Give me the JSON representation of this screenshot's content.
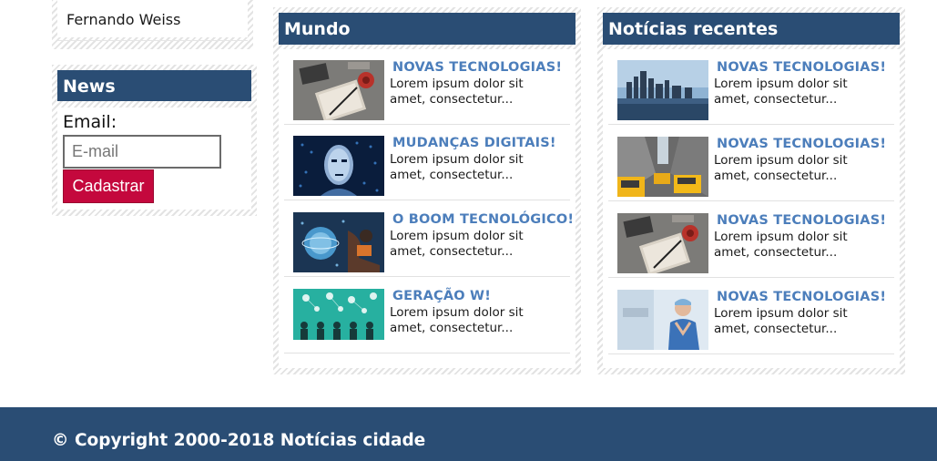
{
  "sidebar": {
    "author_name": "Fernando Weiss",
    "newsletter": {
      "title": "News",
      "email_label": "Email:",
      "email_placeholder": "E-mail",
      "email_value": "",
      "button_label": "Cadastrar"
    }
  },
  "columns": [
    {
      "title": "Mundo",
      "articles": [
        {
          "title": "NOVAS TECNOLOGIAS!",
          "excerpt": "Lorem ipsum dolor sit amet, consectetur...",
          "image": "desk-notebook-photo"
        },
        {
          "title": "MUDANÇAS DIGITAIS!",
          "excerpt": "Lorem ipsum dolor sit amet, consectetur...",
          "image": "digital-face-photo"
        },
        {
          "title": "O BOOM TECNOLÓGICO!",
          "excerpt": "Lorem ipsum dolor sit amet, consectetur...",
          "image": "digital-globe-photo"
        },
        {
          "title": "GERAÇÃO W!",
          "excerpt": "Lorem ipsum dolor sit amet, consectetur...",
          "image": "social-network-illustration"
        }
      ]
    },
    {
      "title": "Notícias recentes",
      "articles": [
        {
          "title": "NOVAS TECNOLOGIAS!",
          "excerpt": "Lorem ipsum dolor sit amet, consectetur...",
          "image": "city-skyline-photo"
        },
        {
          "title": "NOVAS TECNOLOGIAS!",
          "excerpt": "Lorem ipsum dolor sit amet, consectetur...",
          "image": "taxi-street-photo"
        },
        {
          "title": "NOVAS TECNOLOGIAS!",
          "excerpt": "Lorem ipsum dolor sit amet, consectetur...",
          "image": "desk-notebook-photo"
        },
        {
          "title": "NOVAS TECNOLOGIAS!",
          "excerpt": "Lorem ipsum dolor sit amet, consectetur...",
          "image": "doctor-photo"
        }
      ]
    }
  ],
  "footer": {
    "copyright": "© Copyright 2000-2018 Notícias cidade"
  },
  "colors": {
    "header_blue": "#2a4d74",
    "article_title": "#4c7ebb",
    "button_red": "#c4083d"
  }
}
